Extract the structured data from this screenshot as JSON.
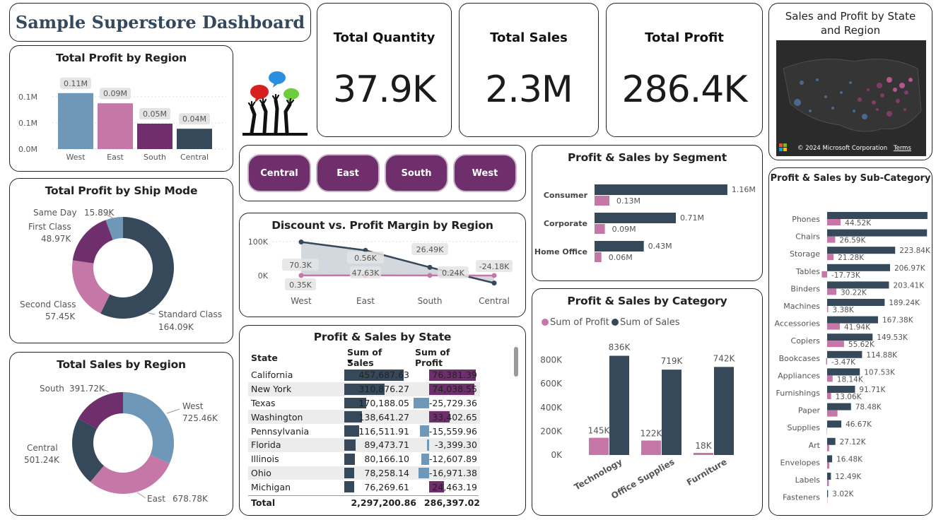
{
  "dashboard_title": "Sample Superstore Dashboard",
  "colors": {
    "navy": "#36495a",
    "pink": "#c578a8",
    "purple": "#6e2f6c",
    "steel": "#6f97b7",
    "grey_label": "#e4e4e4"
  },
  "kpis": [
    {
      "label": "Total Quantity",
      "value": "37.9K"
    },
    {
      "label": "Total Sales",
      "value": "2.3M"
    },
    {
      "label": "Total Profit",
      "value": "286.4K"
    }
  ],
  "logo_icon": "raised-hands-speech-bubbles-icon",
  "profit_by_region": {
    "title": "Total Profit by Region",
    "yticks": [
      "0.1M",
      "0.1M",
      "0.0M"
    ],
    "categories": [
      "West",
      "East",
      "South",
      "Central"
    ],
    "values": [
      0.11,
      0.09,
      0.05,
      0.04
    ],
    "labels": [
      "0.11M",
      "0.09M",
      "0.05M",
      "0.04M"
    ]
  },
  "profit_by_ship_mode": {
    "title": "Total Profit by Ship Mode",
    "slices": [
      {
        "name": "Standard Class",
        "value": 164.09,
        "label": "164.09K"
      },
      {
        "name": "Second Class",
        "value": 57.45,
        "label": "57.45K"
      },
      {
        "name": "First Class",
        "value": 48.97,
        "label": "48.97K"
      },
      {
        "name": "Same Day",
        "value": 15.89,
        "label": "15.89K"
      }
    ]
  },
  "sales_by_region": {
    "title": "Total Sales by Region",
    "slices": [
      {
        "name": "West",
        "value": 725.46,
        "label": "725.46K"
      },
      {
        "name": "East",
        "value": 678.78,
        "label": "678.78K"
      },
      {
        "name": "Central",
        "value": 501.24,
        "label": "501.24K"
      },
      {
        "name": "South",
        "value": 391.72,
        "label": "391.72K"
      }
    ]
  },
  "slicer": [
    "Central",
    "East",
    "South",
    "West"
  ],
  "discount_margin": {
    "title": "Discount vs. Profit Margin by Region",
    "yticks": [
      "100K",
      "0K"
    ],
    "categories": [
      "West",
      "East",
      "South",
      "Central"
    ],
    "series_a": [
      108,
      81,
      26.49,
      -24.18
    ],
    "series_b": [
      0.35,
      0.56,
      0.24,
      0.1
    ],
    "labels_top": [
      "70.3K",
      "0.56K",
      "26.49K",
      "-24.18K"
    ],
    "labels_bottom": [
      "0.35K",
      "47.63K",
      "0.24K",
      ""
    ]
  },
  "state_table": {
    "title": "Profit & Sales by State",
    "columns": [
      "State",
      "Sum of Sales",
      "Sum of Profit"
    ],
    "rows": [
      {
        "state": "California",
        "sales": "457,687.63",
        "profit": "76,381.39",
        "s": 457687.63,
        "p": 76381.39
      },
      {
        "state": "New York",
        "sales": "310,876.27",
        "profit": "74,038.55",
        "s": 310876.27,
        "p": 74038.55
      },
      {
        "state": "Texas",
        "sales": "170,188.05",
        "profit": "-25,729.36",
        "s": 170188.05,
        "p": -25729.36
      },
      {
        "state": "Washington",
        "sales": "138,641.27",
        "profit": "33,402.65",
        "s": 138641.27,
        "p": 33402.65
      },
      {
        "state": "Pennsylvania",
        "sales": "116,511.91",
        "profit": "-15,559.96",
        "s": 116511.91,
        "p": -15559.96
      },
      {
        "state": "Florida",
        "sales": "89,473.71",
        "profit": "-3,399.30",
        "s": 89473.71,
        "p": -3399.3
      },
      {
        "state": "Illinois",
        "sales": "80,166.10",
        "profit": "-12,607.89",
        "s": 80166.1,
        "p": -12607.89
      },
      {
        "state": "Ohio",
        "sales": "78,258.14",
        "profit": "-16,971.38",
        "s": 78258.14,
        "p": -16971.38
      },
      {
        "state": "Michigan",
        "sales": "76,269.61",
        "profit": "24,463.19",
        "s": 76269.61,
        "p": 24463.19
      }
    ],
    "total": {
      "label": "Total",
      "sales": "2,297,200.86",
      "profit": "286,397.02"
    }
  },
  "segment": {
    "title": "Profit & Sales by Segment",
    "rows": [
      {
        "name": "Consumer",
        "sales": 1.16,
        "profit": 0.13,
        "sales_label": "1.16M",
        "profit_label": "0.13M"
      },
      {
        "name": "Corporate",
        "sales": 0.71,
        "profit": 0.09,
        "sales_label": "0.71M",
        "profit_label": "0.09M"
      },
      {
        "name": "Home Office",
        "sales": 0.43,
        "profit": 0.06,
        "sales_label": "0.43M",
        "profit_label": "0.06M"
      }
    ]
  },
  "category": {
    "title": "Profit & Sales by Category",
    "legend": [
      "Sum of Profit",
      "Sum of Sales"
    ],
    "yticks": [
      "800K",
      "600K",
      "400K",
      "200K",
      "0K"
    ],
    "categories": [
      "Technology",
      "Office Supplies",
      "Furniture"
    ],
    "profit": [
      145,
      122,
      18
    ],
    "sales": [
      836,
      719,
      742
    ],
    "profit_labels": [
      "145K",
      "122K",
      "18K"
    ],
    "sales_labels": [
      "836K",
      "719K",
      "742K"
    ]
  },
  "map": {
    "title": "Sales and Profit by State and Region",
    "attribution": "© 2024 Microsoft Corporation",
    "terms": "Terms",
    "brand": "Microsoft Bing"
  },
  "subcategory": {
    "title": "Profit & Sales by Sub-Category",
    "rows": [
      {
        "name": "Phones",
        "sales": 330.01,
        "profit": 44.52,
        "sales_label": "330.01K",
        "profit_label": "44.52K"
      },
      {
        "name": "Chairs",
        "sales": 328.45,
        "profit": 26.59,
        "sales_label": "328.45K",
        "profit_label": "26.59K"
      },
      {
        "name": "Storage",
        "sales": 223.84,
        "profit": 21.28,
        "sales_label": "223.84K",
        "profit_label": "21.28K"
      },
      {
        "name": "Tables",
        "sales": 206.97,
        "profit": -17.73,
        "sales_label": "206.97K",
        "profit_label": "-17.73K"
      },
      {
        "name": "Binders",
        "sales": 203.41,
        "profit": 30.22,
        "sales_label": "203.41K",
        "profit_label": "30.22K"
      },
      {
        "name": "Machines",
        "sales": 189.24,
        "profit": 3.38,
        "sales_label": "189.24K",
        "profit_label": "3.38K"
      },
      {
        "name": "Accessories",
        "sales": 167.38,
        "profit": 41.94,
        "sales_label": "167.38K",
        "profit_label": "41.94K"
      },
      {
        "name": "Copiers",
        "sales": 149.53,
        "profit": 55.62,
        "sales_label": "149.53K",
        "profit_label": "55.62K"
      },
      {
        "name": "Bookcases",
        "sales": 114.88,
        "profit": -3.47,
        "sales_label": "114.88K",
        "profit_label": "-3.47K"
      },
      {
        "name": "Appliances",
        "sales": 107.53,
        "profit": 18.14,
        "sales_label": "107.53K",
        "profit_label": "18.14K"
      },
      {
        "name": "Furnishings",
        "sales": 91.71,
        "profit": 13.06,
        "sales_label": "91.71K",
        "profit_label": "13.06K"
      },
      {
        "name": "Paper",
        "sales": 78.48,
        "profit": 34.05,
        "sales_label": "78.48K",
        "profit_label": ""
      },
      {
        "name": "Supplies",
        "sales": 46.67,
        "profit": -1.19,
        "sales_label": "46.67K",
        "profit_label": ""
      },
      {
        "name": "Art",
        "sales": 27.12,
        "profit": 6.53,
        "sales_label": "27.12K",
        "profit_label": ""
      },
      {
        "name": "Envelopes",
        "sales": 16.48,
        "profit": 6.96,
        "sales_label": "16.48K",
        "profit_label": ""
      },
      {
        "name": "Labels",
        "sales": 12.49,
        "profit": 5.55,
        "sales_label": "12.49K",
        "profit_label": ""
      },
      {
        "name": "Fasteners",
        "sales": 3.02,
        "profit": 0.95,
        "sales_label": "3.02K",
        "profit_label": ""
      }
    ]
  }
}
